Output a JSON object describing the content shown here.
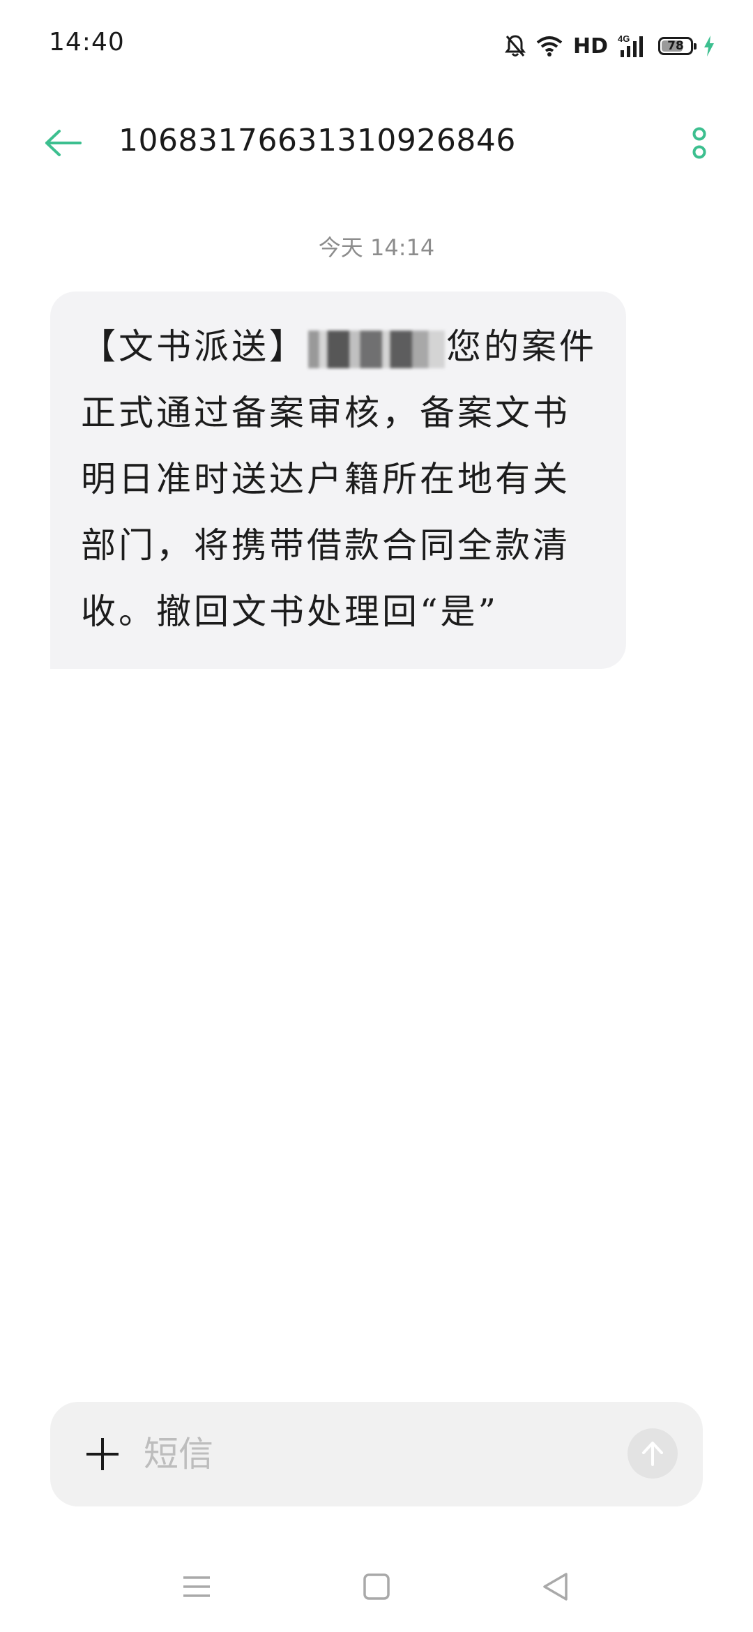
{
  "status_bar": {
    "time": "14:40",
    "network_label": "HD",
    "network_type": "4G",
    "battery_level": 78,
    "icons": [
      "mute-bell-icon",
      "wifi-icon",
      "signal-icon",
      "battery-icon",
      "charging-bolt-icon"
    ]
  },
  "header": {
    "contact_number": "1068317663131092684​6"
  },
  "conversation": {
    "timestamp": "今天 14:14",
    "message": {
      "prefix": "【文书派送】",
      "suffix": "您的案件正式通过备案审核，备案文书明日准时送达户籍所在地有关部门，将携带借款合同全款清收。撤回文书处理回“是”"
    }
  },
  "composer": {
    "placeholder": "短信"
  },
  "colors": {
    "accent": "#3cbf8f",
    "bubble": "#f3f3f5",
    "input_bg": "#f1f1f1",
    "timestamp": "#8c8c8c"
  }
}
